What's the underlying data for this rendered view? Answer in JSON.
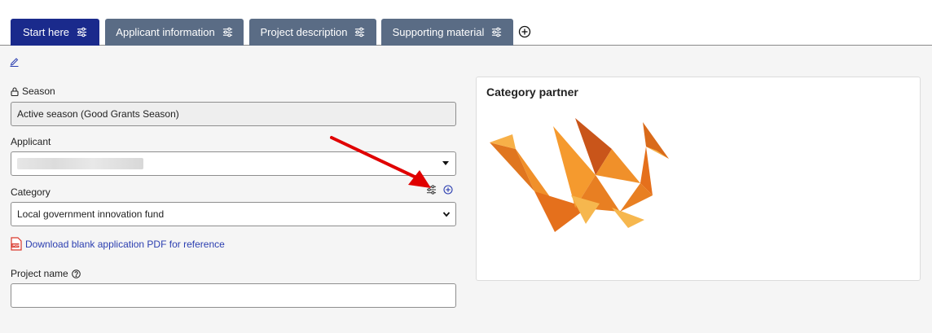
{
  "tabs": [
    {
      "label": "Start here",
      "active": true
    },
    {
      "label": "Applicant information",
      "active": false
    },
    {
      "label": "Project description",
      "active": false
    },
    {
      "label": "Supporting material",
      "active": false
    }
  ],
  "form": {
    "season_label": "Season",
    "season_value": "Active season (Good Grants Season)",
    "applicant_label": "Applicant",
    "category_label": "Category",
    "category_value": "Local government innovation fund",
    "pdf_link": "Download blank application PDF for reference",
    "project_name_label": "Project name",
    "project_name_value": ""
  },
  "partner": {
    "title": "Category partner"
  },
  "colors": {
    "active_tab": "#1a2a8c",
    "inactive_tab": "#5a6c85",
    "link": "#2b3eb0",
    "annotation_arrow": "#e00000"
  },
  "icons": [
    "sliders-icon",
    "add-tab-icon",
    "edit-icon",
    "lock-icon",
    "help-icon",
    "pdf-file-icon",
    "add-category-icon",
    "chevron-down-icon",
    "dragon-logo"
  ]
}
